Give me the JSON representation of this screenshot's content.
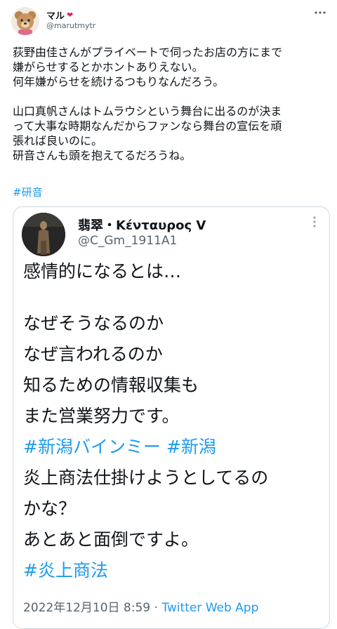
{
  "author": {
    "display_name": "マル",
    "handle": "@marutmytr",
    "name_emoji": "heart-emoji"
  },
  "tweet": {
    "text": "荻野由佳さんがプライベートで伺ったお店の方にまで\n嫌がらせするとかホントありえない。\n何年嫌がらせを続けるつもりなんだろう。\n\n山口真帆さんはトムラウシという舞台に出るのが決ま\nって大事な時期なんだからファンなら舞台の宣伝を頑\n張れば良いのに。\n研音さんも頭を抱えてるだろうね。",
    "hashtag": "#研音"
  },
  "quoted": {
    "display_name": "翡翠・Κένταυρος V",
    "handle": "@C_Gm_1911A1",
    "lines": [
      "感情的になるとは…",
      "",
      "なぜそうなるのか",
      "なぜ言われるのか",
      "知るための情報収集も",
      "また営業努力です。"
    ],
    "tag_line": [
      "#新潟バインミー",
      "#新潟"
    ],
    "lines2": [
      "炎上商法仕掛けようとしてるの",
      "かな？",
      "あとあと面倒ですよ。"
    ],
    "tag_last": "#炎上商法",
    "timestamp": "2022年12月10日 8:59",
    "separator": " · ",
    "source": "Twitter Web App"
  },
  "icons": {
    "more": "more-options-icon",
    "avatar": "teddy-bear-avatar",
    "quoted_avatar": "silhouette-avatar"
  }
}
